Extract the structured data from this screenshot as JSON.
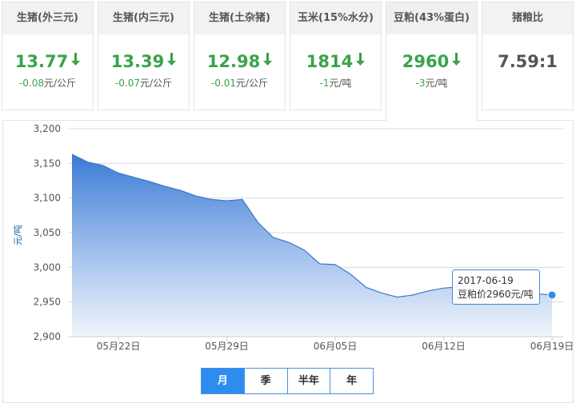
{
  "cards": [
    {
      "title": "生猪(外三元)",
      "price": "13.77",
      "direction": "down",
      "change": "-0.08",
      "unit": "元/公斤"
    },
    {
      "title": "生猪(内三元)",
      "price": "13.39",
      "direction": "down",
      "change": "-0.07",
      "unit": "元/公斤"
    },
    {
      "title": "生猪(土杂猪)",
      "price": "12.98",
      "direction": "down",
      "change": "-0.01",
      "unit": "元/公斤"
    },
    {
      "title": "玉米(15%水分)",
      "price": "1814",
      "direction": "down",
      "change": "-1",
      "unit": "元/吨"
    },
    {
      "title": "豆粕(43%蛋白)",
      "price": "2960",
      "direction": "down",
      "change": "-3",
      "unit": "元/吨",
      "active": true
    },
    {
      "title": "猪粮比",
      "price": "7.59:1",
      "direction": "none",
      "change": "",
      "unit": ""
    }
  ],
  "colors": {
    "up_green": "#3aa34a",
    "area_top": "#3a7bd5",
    "line": "#3b78cc",
    "tab_active": "#2d8cf0"
  },
  "tooltip": {
    "date": "2017-06-19",
    "label": "豆粕价2960元/吨"
  },
  "range_tabs": [
    {
      "label": "月",
      "active": true
    },
    {
      "label": "季",
      "active": false
    },
    {
      "label": "半年",
      "active": false
    },
    {
      "label": "年",
      "active": false
    }
  ],
  "chart_data": {
    "type": "area",
    "ylabel": "元/吨",
    "ylim": [
      2900,
      3200
    ],
    "y_ticks": [
      2900,
      2950,
      3000,
      3050,
      3100,
      3150,
      3200
    ],
    "y_tick_labels": [
      "2,900",
      "2,950",
      "3,000",
      "3,050",
      "3,100",
      "3,150",
      "3,200"
    ],
    "x_ticks": [
      "05月22日",
      "05月29日",
      "06月05日",
      "06月12日",
      "06月19日"
    ],
    "grid": true,
    "series": [
      {
        "name": "豆粕价",
        "x": [
          "2017-05-19",
          "2017-05-20",
          "2017-05-21",
          "2017-05-22",
          "2017-05-23",
          "2017-05-24",
          "2017-05-25",
          "2017-05-26",
          "2017-05-27",
          "2017-05-28",
          "2017-05-29",
          "2017-05-30",
          "2017-05-31",
          "2017-06-01",
          "2017-06-02",
          "2017-06-03",
          "2017-06-04",
          "2017-06-05",
          "2017-06-06",
          "2017-06-07",
          "2017-06-08",
          "2017-06-09",
          "2017-06-10",
          "2017-06-11",
          "2017-06-12",
          "2017-06-13",
          "2017-06-14",
          "2017-06-15",
          "2017-06-16",
          "2017-06-17",
          "2017-06-18",
          "2017-06-19"
        ],
        "values": [
          3163,
          3152,
          3147,
          3136,
          3130,
          3124,
          3117,
          3111,
          3103,
          3098,
          3096,
          3098,
          3065,
          3043,
          3036,
          3025,
          3005,
          3004,
          2990,
          2971,
          2963,
          2957,
          2960,
          2966,
          2970,
          2972,
          2975,
          2972,
          2970,
          2966,
          2962,
          2960
        ]
      }
    ]
  }
}
